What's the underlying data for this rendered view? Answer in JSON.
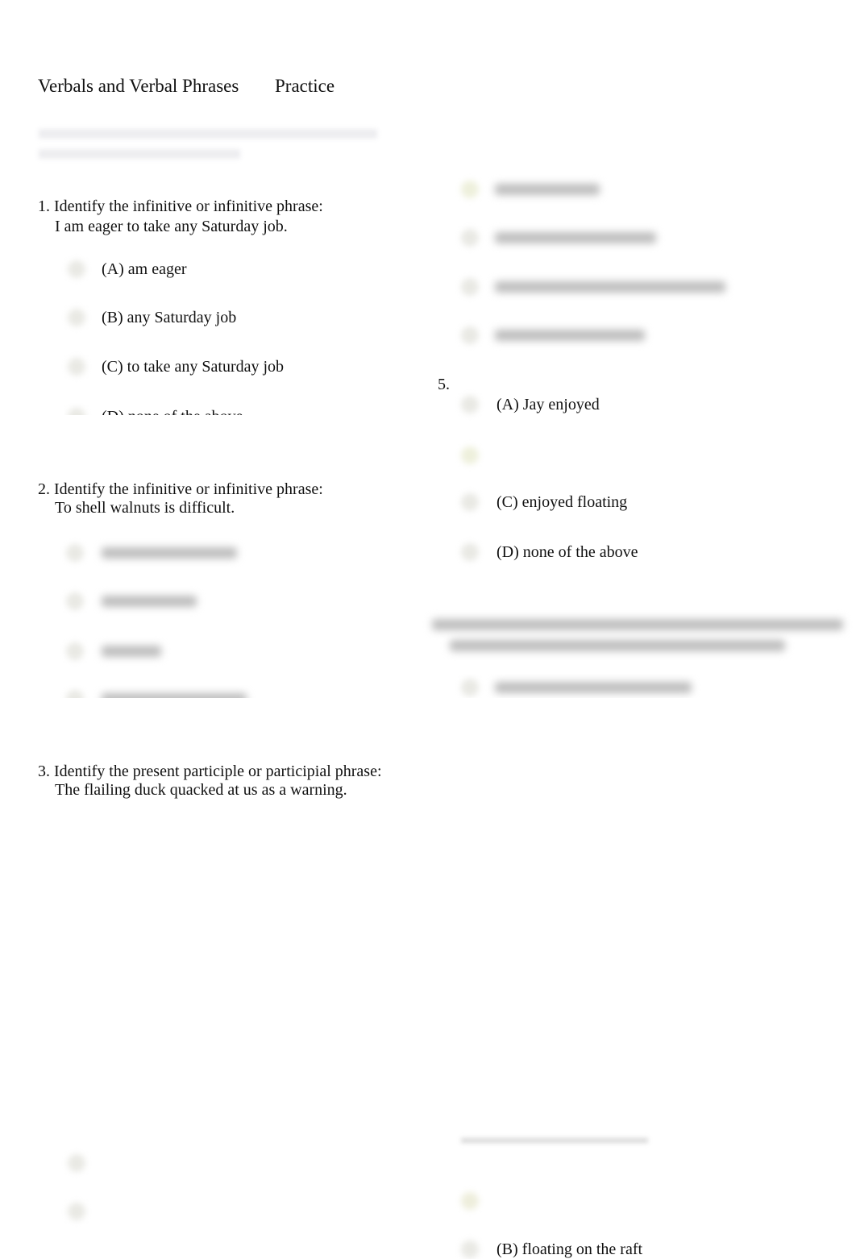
{
  "header": {
    "title": "Verbals and Verbal Phrases",
    "subtitle": "Practice"
  },
  "questions": [
    {
      "number": "1.",
      "prompt": "Identify the infinitive or infinitive phrase:",
      "sentence": "I am eager to take any Saturday job.",
      "options": [
        "(A) am eager",
        "(B) any Saturday job",
        "(C) to take any Saturday job",
        "(D) none of the above"
      ]
    },
    {
      "number": "2.",
      "prompt": "Identify the infinitive or infinitive phrase:",
      "sentence": "To shell walnuts is difficult."
    },
    {
      "number": "3.",
      "prompt": "Identify the present participle or participial phrase:",
      "sentence": "The flailing duck quacked at us as a warning."
    },
    {
      "number": "5.",
      "options": [
        "(A) Jay enjoyed",
        "(C) enjoyed floating",
        "(D) none of the above"
      ]
    },
    {
      "options": [
        "(B) floating on the raft"
      ]
    }
  ]
}
